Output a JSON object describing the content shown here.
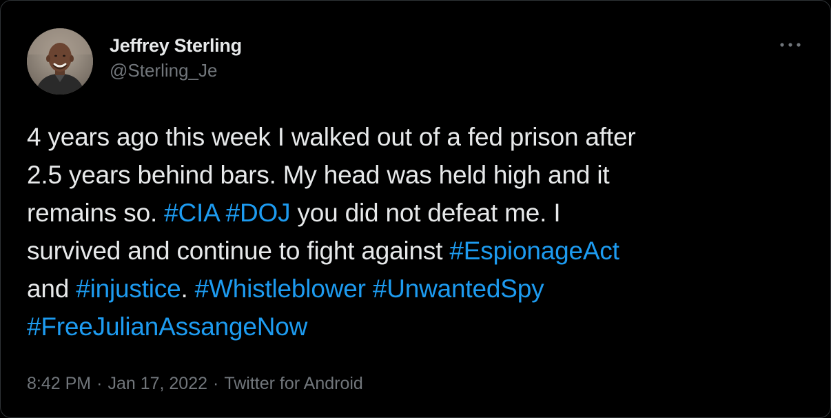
{
  "author": {
    "display_name": "Jeffrey Sterling",
    "handle": "@Sterling_Je",
    "avatar_icon": "profile-photo"
  },
  "menu": {
    "more_icon": "more-horizontal-icon"
  },
  "tweet": {
    "lines": [
      [
        {
          "text": "4 years ago this week I walked out of a fed prison after"
        }
      ],
      [
        {
          "text": "2.5 years behind bars. My head was held high and it"
        }
      ],
      [
        {
          "text": "remains so. "
        },
        {
          "hashtag": "#CIA"
        },
        {
          "text": " "
        },
        {
          "hashtag": "#DOJ"
        },
        {
          "text": " you did not defeat me. I"
        }
      ],
      [
        {
          "text": "survived and continue to fight against "
        },
        {
          "hashtag": "#EspionageAct"
        }
      ],
      [
        {
          "text": "and "
        },
        {
          "hashtag": "#injustice"
        },
        {
          "text": ". "
        },
        {
          "hashtag": "#Whistleblower"
        },
        {
          "text": " "
        },
        {
          "hashtag": "#UnwantedSpy"
        }
      ],
      [
        {
          "hashtag": "#FreeJulianAssangeNow"
        }
      ]
    ]
  },
  "meta": {
    "time": "8:42 PM",
    "separator": "·",
    "date": "Jan 17, 2022",
    "source": "Twitter for Android"
  },
  "colors": {
    "background": "#000000",
    "text": "#e7e9ea",
    "secondary": "#71767b",
    "hashtag": "#1d9bf0",
    "border": "#2f3336"
  }
}
